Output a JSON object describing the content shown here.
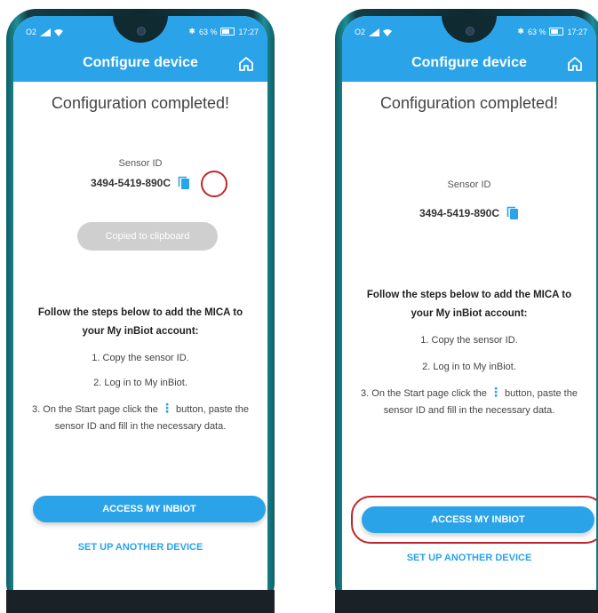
{
  "status": {
    "carrier": "O2",
    "battery": "63 %",
    "time": "17:27",
    "bt": "✱"
  },
  "appbar": {
    "title": "Configure device",
    "home_icon": "home-icon"
  },
  "content": {
    "heading": "Configuration completed!",
    "sensor_label": "Sensor ID",
    "sensor_id": "3494-5419-890C",
    "toast": "Copied to clipboard",
    "instructions_title": "Follow the steps below to add the MICA to your My inBiot account:",
    "step1": "1. Copy the sensor ID.",
    "step2": "2. Log in to My inBiot.",
    "step3_prefix": "3. On the Start page click the",
    "step3_suffix": "button, paste the sensor ID and fill in the necessary data.",
    "menu_glyph": "⋮",
    "primary_button": "ACCESS MY INBIOT",
    "secondary_link": "SET UP ANOTHER DEVICE"
  },
  "colors": {
    "accent": "#2aa3e9",
    "highlight": "#c0272d",
    "toast_bg": "#cfcfcf"
  }
}
